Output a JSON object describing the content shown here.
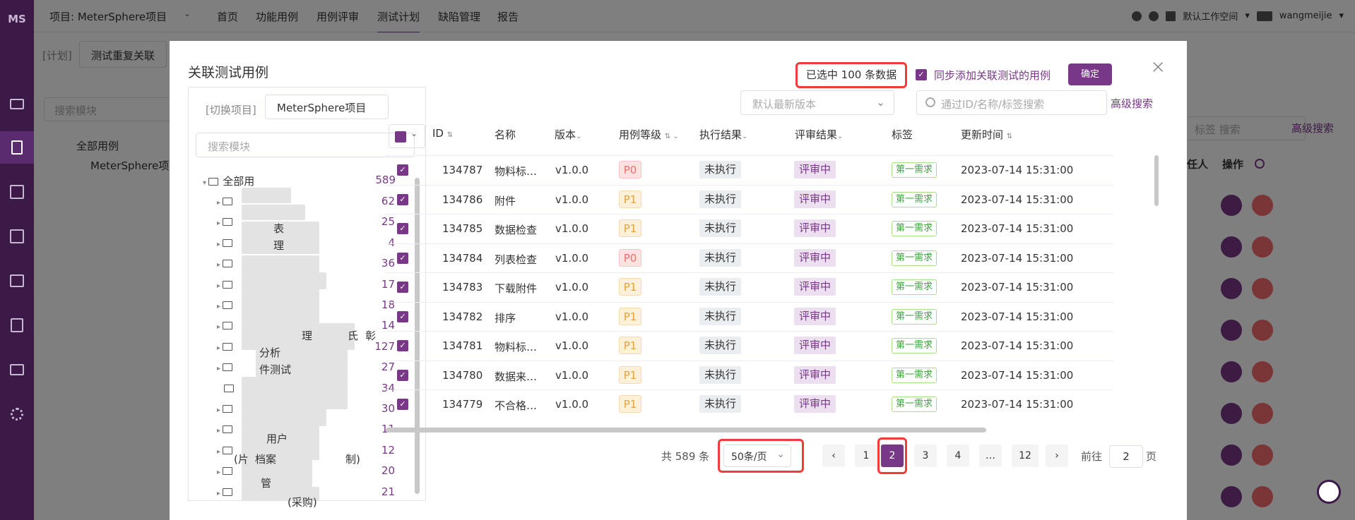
{
  "topbar": {
    "project": "项目: MeterSphere项目",
    "menus": [
      "首页",
      "功能用例",
      "用例评审",
      "测试计划",
      "缺陷管理",
      "报告"
    ],
    "workspace": "默认工作空间",
    "user": "wangmeijie"
  },
  "subbar": {
    "plan_tag": "[计划]",
    "plan_name": "测试重复关联",
    "search_module": "搜索模块",
    "tree_all": "全部用例",
    "tree_proj": "MeterSphere项"
  },
  "rightbg": {
    "search_ph": "标签 搜索",
    "adv": "高级搜索",
    "col_owner": "任人",
    "col_op": "操作"
  },
  "dialog": {
    "title": "关联测试用例",
    "selected": "已选中 100 条数据",
    "sync_label": "同步添加关联测试的用例",
    "confirm": "确定",
    "version_placeholder": "默认最新版本",
    "search_placeholder": "通过ID/名称/标签搜索",
    "advanced": "高级搜索",
    "switch_label": "[切换项目]",
    "project": "MeterSphere项目",
    "module_search": "搜索模块",
    "tree_root": "全部用",
    "tree_root_count": "589",
    "tree_counts": [
      "62",
      "25",
      "4",
      "36",
      "17",
      "18",
      "14",
      "127",
      "27",
      "34",
      "30",
      "11",
      "12",
      "20",
      "21"
    ],
    "tree_fragments": [
      "表",
      "理",
      "彰",
      "氏",
      "理",
      "分析",
      "件测试",
      "用户",
      "(片",
      "档案",
      "制)",
      "管",
      "(采购)"
    ]
  },
  "table": {
    "headers": {
      "id": "ID",
      "name": "名称",
      "version": "版本",
      "level": "用例等级",
      "exec": "执行结果",
      "review": "评审结果",
      "tag": "标签",
      "update": "更新时间"
    },
    "rows": [
      {
        "id": "134787",
        "name": "物料标…",
        "ver": "v1.0.0",
        "lvl": "P0",
        "exec": "未执行",
        "rev": "评审中",
        "tag": "第一需求",
        "time": "2023-07-14 15:31:00"
      },
      {
        "id": "134786",
        "name": "附件",
        "ver": "v1.0.0",
        "lvl": "P1",
        "exec": "未执行",
        "rev": "评审中",
        "tag": "第一需求",
        "time": "2023-07-14 15:31:00"
      },
      {
        "id": "134785",
        "name": "数据检查",
        "ver": "v1.0.0",
        "lvl": "P1",
        "exec": "未执行",
        "rev": "评审中",
        "tag": "第一需求",
        "time": "2023-07-14 15:31:00"
      },
      {
        "id": "134784",
        "name": "列表检查",
        "ver": "v1.0.0",
        "lvl": "P0",
        "exec": "未执行",
        "rev": "评审中",
        "tag": "第一需求",
        "time": "2023-07-14 15:31:00"
      },
      {
        "id": "134783",
        "name": "下载附件",
        "ver": "v1.0.0",
        "lvl": "P1",
        "exec": "未执行",
        "rev": "评审中",
        "tag": "第一需求",
        "time": "2023-07-14 15:31:00"
      },
      {
        "id": "134782",
        "name": "排序",
        "ver": "v1.0.0",
        "lvl": "P1",
        "exec": "未执行",
        "rev": "评审中",
        "tag": "第一需求",
        "time": "2023-07-14 15:31:00"
      },
      {
        "id": "134781",
        "name": "物料标…",
        "ver": "v1.0.0",
        "lvl": "P1",
        "exec": "未执行",
        "rev": "评审中",
        "tag": "第一需求",
        "time": "2023-07-14 15:31:00"
      },
      {
        "id": "134780",
        "name": "数据来…",
        "ver": "v1.0.0",
        "lvl": "P1",
        "exec": "未执行",
        "rev": "评审中",
        "tag": "第一需求",
        "time": "2023-07-14 15:31:00"
      },
      {
        "id": "134779",
        "name": "不合格…",
        "ver": "v1.0.0",
        "lvl": "P1",
        "exec": "未执行",
        "rev": "评审中",
        "tag": "第一需求",
        "time": "2023-07-14 15:31:00"
      }
    ]
  },
  "pager": {
    "total": "共 589 条",
    "size": "50条/页",
    "pages": [
      "1",
      "2",
      "3",
      "4",
      "…",
      "12"
    ],
    "current": "2",
    "goto_label": "前往",
    "goto_value": "2",
    "page_unit": "页",
    "prev": "‹",
    "next": "›"
  },
  "colors": {
    "accent": "#783887",
    "highlight": "#f23c3c"
  }
}
